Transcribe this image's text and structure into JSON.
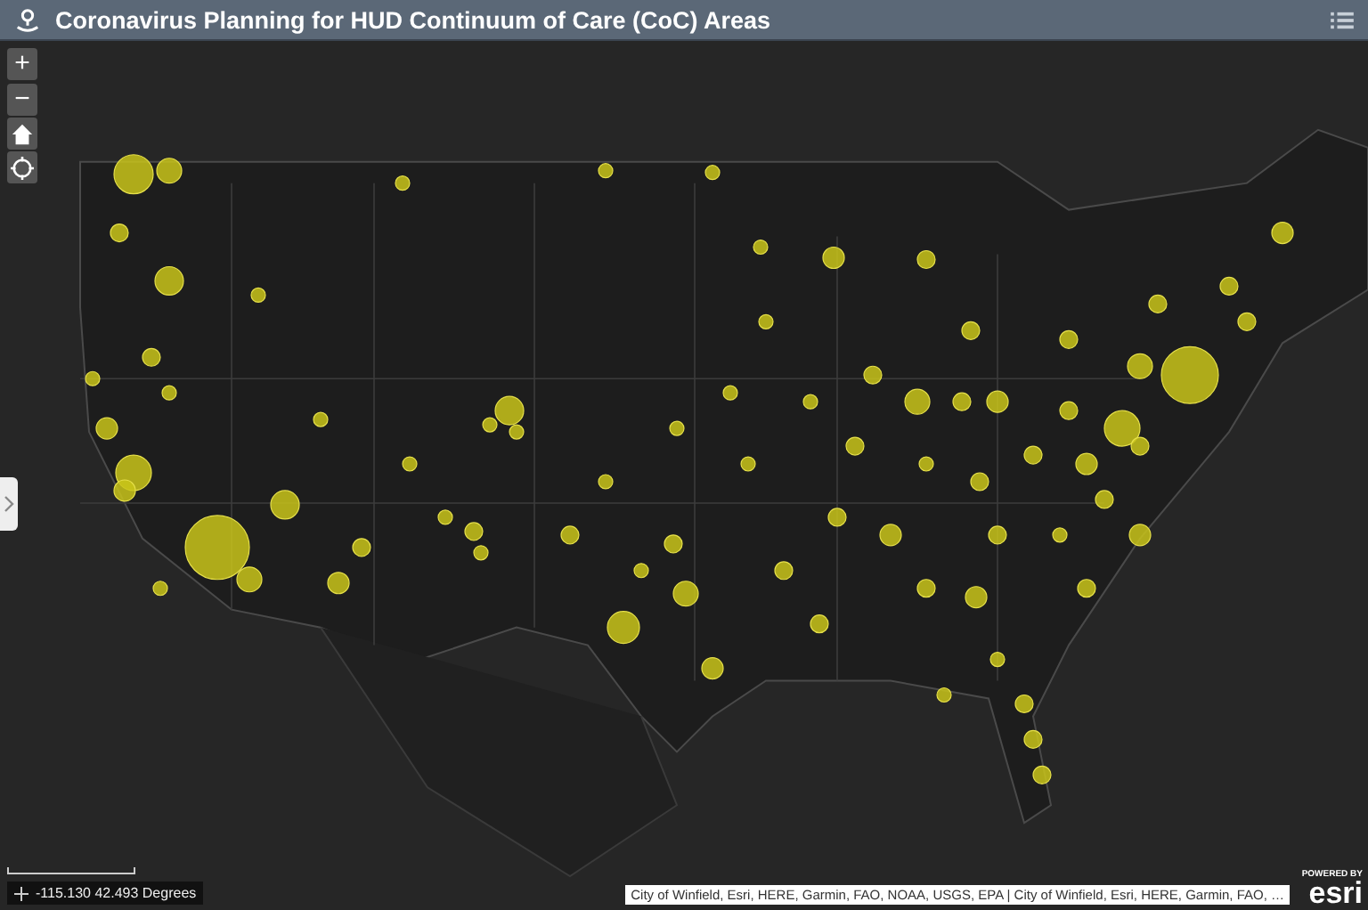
{
  "header": {
    "title": "Coronavirus Planning for HUD Continuum of Care (CoC) Areas"
  },
  "zoom_controls": {
    "zoom_in": "+",
    "zoom_out": "−"
  },
  "coordinates": "-115.130 42.493 Degrees",
  "attribution": "City of Winfield, Esri, HERE, Garmin, FAO, NOAA, USGS, EPA | City of Winfield, Esri, HERE, Garmin, FAO, …",
  "logo": {
    "tagline": "POWERED BY",
    "name": "esri"
  }
}
